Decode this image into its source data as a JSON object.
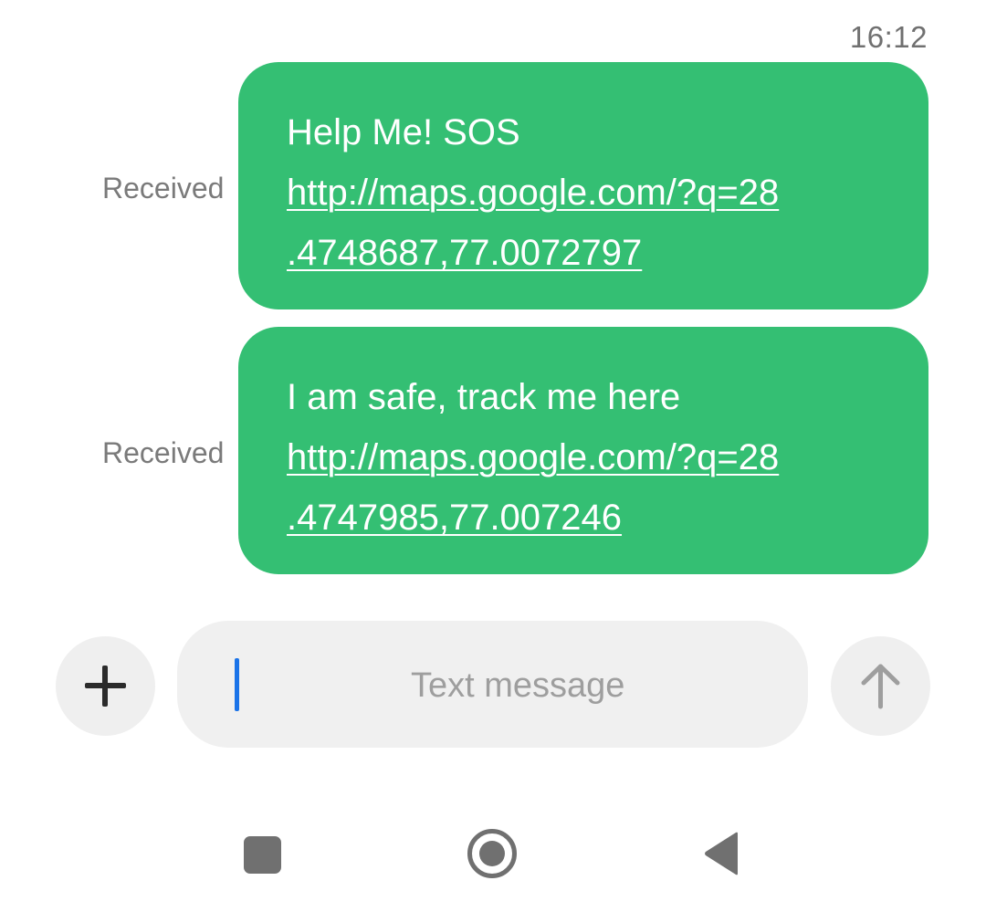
{
  "conversation": {
    "timestamp": "16:12",
    "messages": [
      {
        "status": "Received",
        "text": "Help Me! SOS",
        "link_line1": "http://maps.google.com/?q=28",
        "link_line2": ".4748687,77.0072797"
      },
      {
        "status": "Received",
        "text": "I am safe, track me here",
        "link_line1": "http://maps.google.com/?q=28",
        "link_line2": ".4747985,77.007246"
      }
    ]
  },
  "composer": {
    "add_icon": "plus-icon",
    "placeholder": "Text message",
    "value": "",
    "send_icon": "arrow-up-icon"
  },
  "navigation": {
    "recents_icon": "square-icon",
    "home_icon": "circle-icon",
    "back_icon": "triangle-back-icon"
  },
  "colors": {
    "bubble": "#34bf73",
    "bubble_text": "#ffffff",
    "cursor": "#1a73e8",
    "control_background": "#efefef"
  }
}
